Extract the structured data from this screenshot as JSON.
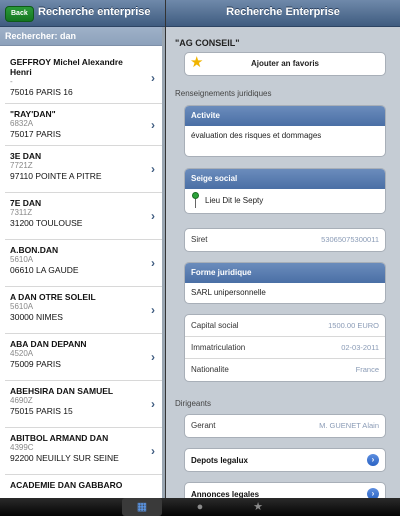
{
  "left": {
    "back_label": "Back",
    "title": "Recherche enterprise",
    "search_label": "Rechercher: dan",
    "results": [
      {
        "name": "GEFFROY Michel Alexandre Henri",
        "code": "-",
        "city": "75016 PARIS 16"
      },
      {
        "name": "\"RAY'DAN\"",
        "code": "6832A",
        "city": "75017 PARIS"
      },
      {
        "name": "3E DAN",
        "code": "7721Z",
        "city": "97110 POINTE A PITRE"
      },
      {
        "name": "7E DAN",
        "code": "7311Z",
        "city": "31200 TOULOUSE"
      },
      {
        "name": "A.BON.DAN",
        "code": "5610A",
        "city": "06610 LA GAUDE"
      },
      {
        "name": "A DAN OTRE SOLEIL",
        "code": "5610A",
        "city": "30000 NIMES"
      },
      {
        "name": "ABA DAN DEPANN",
        "code": "4520A",
        "city": "75009 PARIS"
      },
      {
        "name": "ABEHSIRA DAN SAMUEL",
        "code": "4690Z",
        "city": "75015 PARIS 15"
      },
      {
        "name": "ABITBOL ARMAND DAN",
        "code": "4399C",
        "city": "92200 NEUILLY SUR SEINE"
      },
      {
        "name": "ACADEMIE DAN GABBARO",
        "code": "",
        "city": ""
      }
    ]
  },
  "right": {
    "title": "Recherche Enterprise",
    "company_name": "\"AG CONSEIL\"",
    "favorite_label": "Ajouter an favoris",
    "legal_section": "Renseignements juridiques",
    "activity": {
      "header": "Activite",
      "text": "évaluation des risques et dommages"
    },
    "seat": {
      "header": "Seige social",
      "text": "Lieu Dit le Septy"
    },
    "siret": {
      "label": "Siret",
      "value": "53065075300011"
    },
    "legal_form": {
      "header": "Forme juridique",
      "text": "SARL unipersonnelle"
    },
    "capital": {
      "label": "Capital social",
      "value": "1500.00 EURO"
    },
    "registration": {
      "label": "Immatriculation",
      "value": "02-03-2011"
    },
    "nationality": {
      "label": "Nationalite",
      "value": "France"
    },
    "managers_section": "Dirigeants",
    "manager": {
      "label": "Gerant",
      "value": "M. GUENET Alain"
    },
    "links": {
      "deposits": "Depots legalux",
      "announcements": "Annonces legales"
    }
  },
  "colors": {
    "navbar": "#4a6a92",
    "accent": "#2a63c4",
    "value_text": "#8a9bb6"
  },
  "tabbar": {
    "tabs": [
      "search-tab",
      "profile-tab",
      "favorites-tab"
    ],
    "active": 0
  }
}
